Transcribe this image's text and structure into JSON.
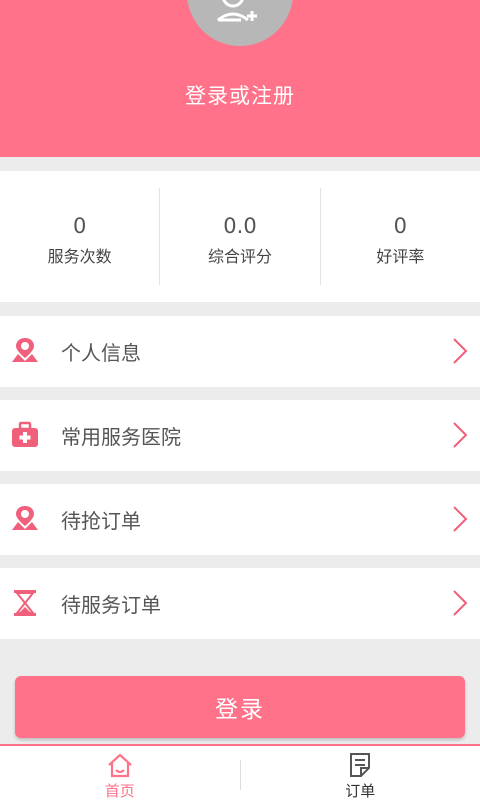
{
  "header": {
    "title": "登录或注册",
    "avatar_icon": "add-user-icon"
  },
  "stats": [
    {
      "value": "0",
      "label": "服务次数"
    },
    {
      "value": "0.0",
      "label": "综合评分"
    },
    {
      "value": "0",
      "label": "好评率"
    }
  ],
  "menu": [
    {
      "label": "个人信息",
      "icon": "location-person-icon"
    },
    {
      "label": "常用服务医院",
      "icon": "medical-kit-icon"
    },
    {
      "label": "待抢订单",
      "icon": "location-person-icon"
    },
    {
      "label": "待服务订单",
      "icon": "hourglass-icon"
    }
  ],
  "login_button": "登录",
  "tabs": [
    {
      "label": "首页",
      "icon": "home-icon",
      "active": true
    },
    {
      "label": "订单",
      "icon": "order-icon",
      "active": false
    }
  ],
  "colors": {
    "accent": "#ff7289",
    "active_tab": "#ff7289",
    "inactive_tab": "#555555"
  }
}
